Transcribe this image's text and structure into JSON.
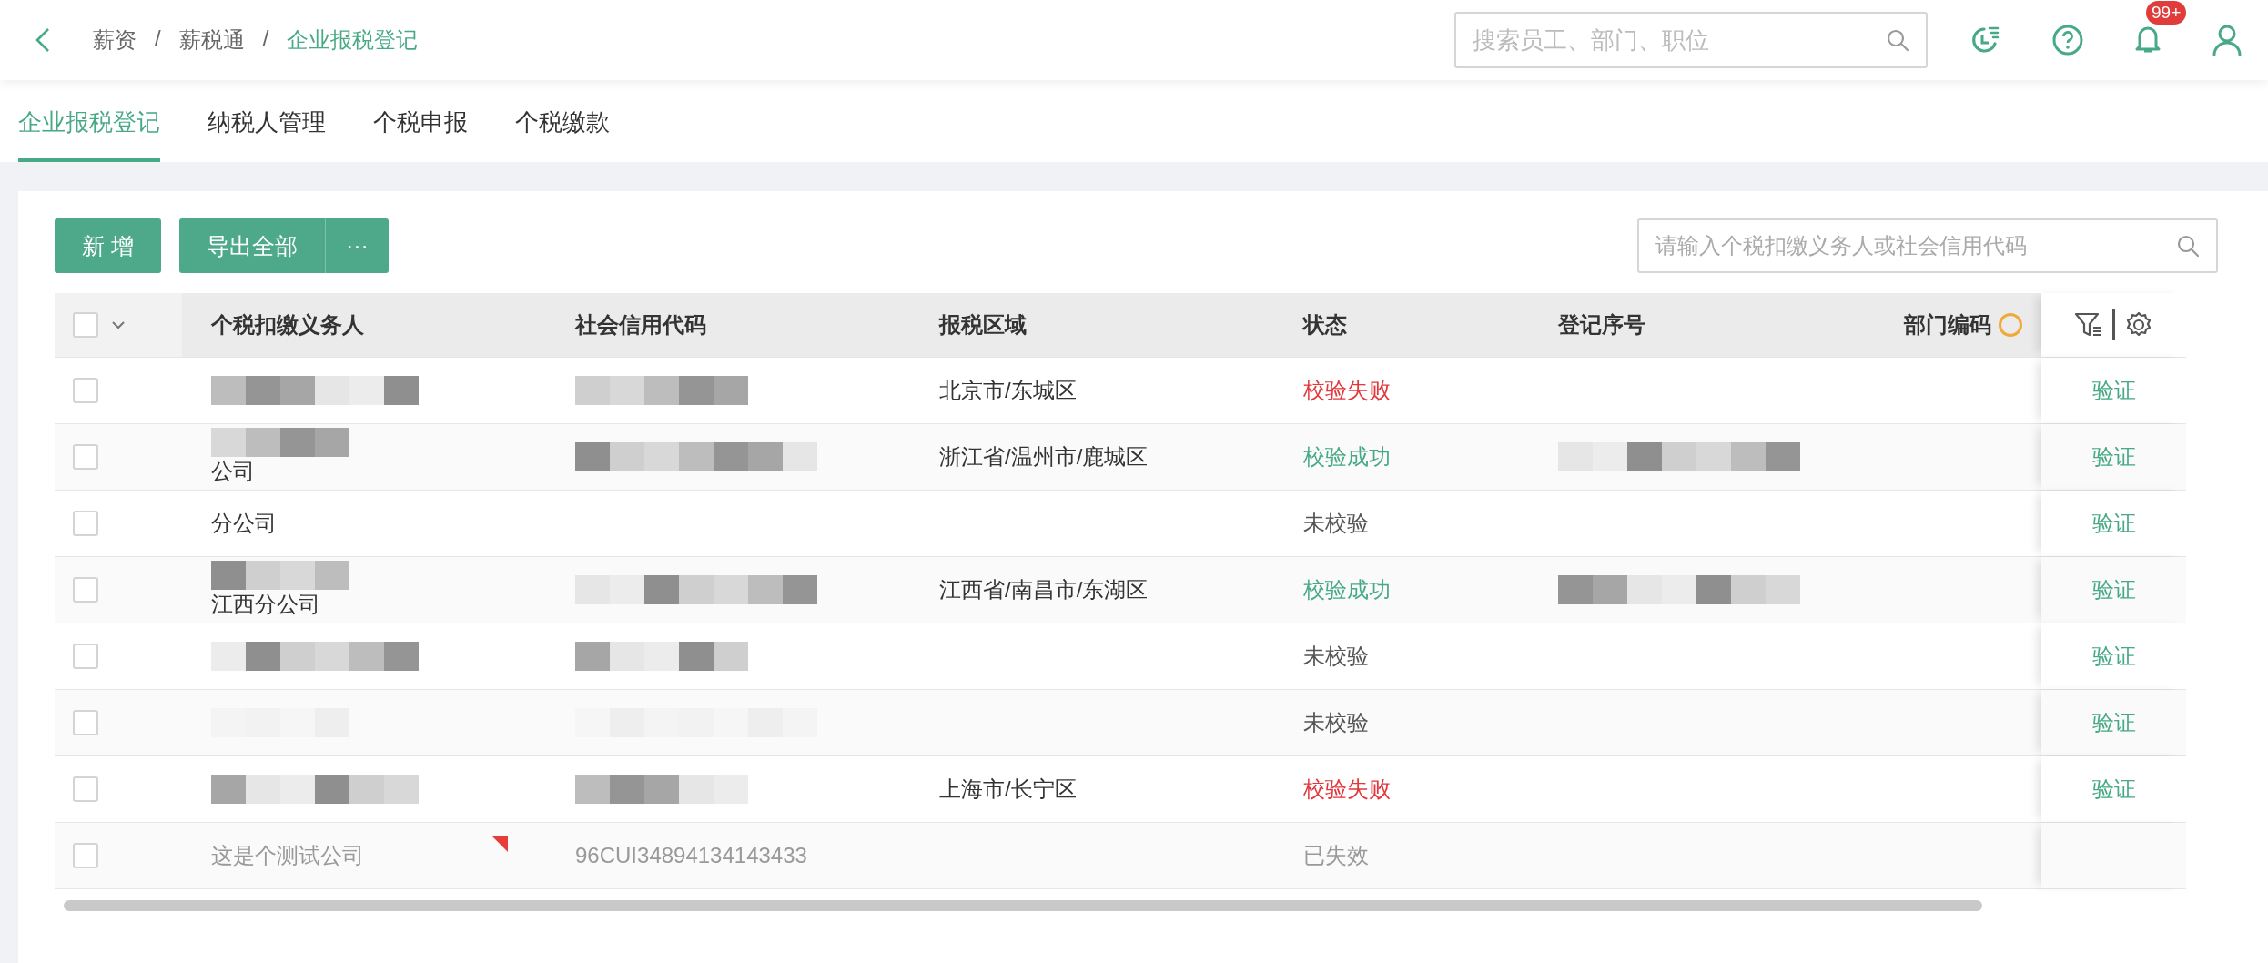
{
  "topbar": {
    "breadcrumb": [
      {
        "label": "薪资",
        "current": false
      },
      {
        "label": "/",
        "current": false
      },
      {
        "label": "薪税通",
        "current": false
      },
      {
        "label": "/",
        "current": false
      },
      {
        "label": "企业报税登记",
        "current": true
      }
    ],
    "search": {
      "placeholder": "搜索员工、部门、职位"
    },
    "notification_badge": "99+"
  },
  "tabs": [
    {
      "label": "企业报税登记",
      "selected": true
    },
    {
      "label": "纳税人管理",
      "selected": false
    },
    {
      "label": "个税申报",
      "selected": false
    },
    {
      "label": "个税缴款",
      "selected": false
    }
  ],
  "toolbar": {
    "buttons": [
      "新 增",
      "导出全部"
    ],
    "more_button": "···",
    "search": {
      "placeholder": "请输入个税扣缴义务人或社会信用代码"
    }
  },
  "table": {
    "columns": [
      "个税扣缴义务人",
      "社会信用代码",
      "报税区域",
      "状态",
      "登记序号",
      "部门编码"
    ],
    "select_all_checked": false,
    "rows": [
      {
        "checked": false,
        "name": "",
        "name_redacted": true,
        "credit_code": "",
        "credit_redacted": true,
        "area": "北京市/东城区",
        "status": {
          "text": "校验失败",
          "color": "#e2373b"
        },
        "reg_redacted": false,
        "action": "验证",
        "disabled": false,
        "flagged": false
      },
      {
        "checked": false,
        "name": "公司",
        "name_redacted": true,
        "credit_code": "",
        "credit_redacted": true,
        "area": "浙江省/温州市/鹿城区",
        "status": {
          "text": "校验成功",
          "color": "#47a985"
        },
        "reg_redacted": true,
        "action": "验证",
        "disabled": false,
        "flagged": false
      },
      {
        "checked": false,
        "name": "分公司",
        "name_redacted": false,
        "credit_code": "",
        "credit_redacted": false,
        "area": "",
        "status": {
          "text": "未校验",
          "color": "#555555"
        },
        "reg_redacted": false,
        "action": "验证",
        "disabled": false,
        "flagged": false
      },
      {
        "checked": false,
        "name": "江西分公司",
        "name_redacted": true,
        "credit_code": "",
        "credit_redacted": true,
        "area": "江西省/南昌市/东湖区",
        "status": {
          "text": "校验成功",
          "color": "#47a985"
        },
        "reg_redacted": true,
        "action": "验证",
        "disabled": false,
        "flagged": false
      },
      {
        "checked": false,
        "name": "",
        "name_redacted": true,
        "credit_code": "",
        "credit_redacted": true,
        "area": "",
        "status": {
          "text": "未校验",
          "color": "#555555"
        },
        "reg_redacted": false,
        "action": "验证",
        "disabled": false,
        "flagged": false
      },
      {
        "checked": false,
        "name": "",
        "name_redacted": true,
        "credit_code": "",
        "credit_redacted": true,
        "area": "",
        "status": {
          "text": "未校验",
          "color": "#555555"
        },
        "reg_redacted": false,
        "action": "验证",
        "disabled": false,
        "flagged": false
      },
      {
        "checked": false,
        "name": "",
        "name_redacted": true,
        "credit_code": "",
        "credit_redacted": true,
        "area": "上海市/长宁区",
        "status": {
          "text": "校验失败",
          "color": "#e2373b"
        },
        "reg_redacted": false,
        "action": "验证",
        "disabled": false,
        "flagged": false
      },
      {
        "checked": false,
        "name": "这是个测试公司",
        "name_redacted": false,
        "credit_code": "96CUI34894134143433",
        "credit_redacted": false,
        "area": "",
        "status": {
          "text": "已失效",
          "color": "#999999"
        },
        "reg_redacted": false,
        "action": "",
        "disabled": true,
        "flagged": true
      }
    ]
  }
}
